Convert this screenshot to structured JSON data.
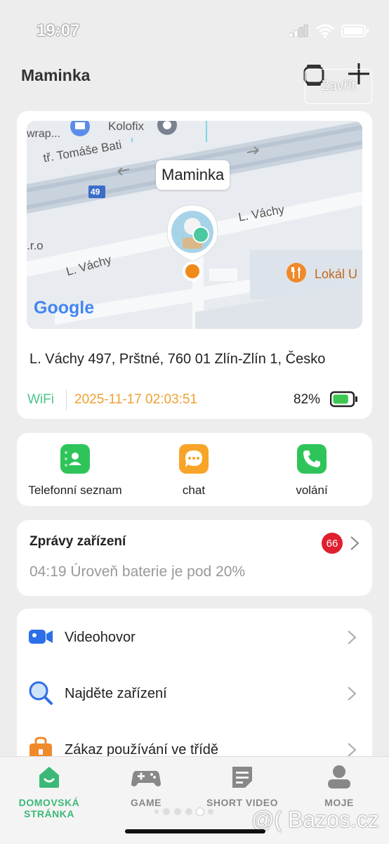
{
  "status": {
    "time": "19:07"
  },
  "header": {
    "title": "Maminka",
    "close_label": "Zavřít"
  },
  "location_card": {
    "map": {
      "pin_label": "Maminka",
      "street_1": "tř. Tomáše Bati",
      "street_2": "L. Váchy",
      "street_3": "L. Váchy",
      "poi_1": "Kolofix",
      "poi_2": "Lokál U",
      "poi_3": "wrap...",
      "road_number": "49",
      "edge_text": ".r.o",
      "provider": "Google"
    },
    "address": "L. Váchy 497, Prštné, 760 01 Zlín-Zlín 1, Česko",
    "connection": "WiFi",
    "timestamp": "2025-11-17 02:03:51",
    "battery_pct": "82%",
    "battery_level": 0.82
  },
  "quick_actions": [
    {
      "label": "Telefonní seznam",
      "icon": "contacts-icon",
      "color": "#2ec45a"
    },
    {
      "label": "chat",
      "icon": "chat-icon",
      "color": "#f7a428"
    },
    {
      "label": "volání",
      "icon": "phone-icon",
      "color": "#2ec45a"
    }
  ],
  "messages": {
    "title": "Zprávy zařízení",
    "badge": "66",
    "latest": "04:19 Úroveň baterie je pod 20%"
  },
  "menu": [
    {
      "label": "Videohovor",
      "icon": "video-camera-icon"
    },
    {
      "label": "Najděte zařízení",
      "icon": "magnifier-icon"
    },
    {
      "label": "Zákaz používání ve třídě",
      "icon": "lock-icon"
    }
  ],
  "bottom_nav": [
    {
      "label": "DOMOVSKÁ STRÁNKA",
      "icon": "home-icon",
      "active": true
    },
    {
      "label": "GAME",
      "icon": "gamepad-icon",
      "active": false
    },
    {
      "label": "SHORT VIDEO",
      "icon": "short-video-icon",
      "active": false
    },
    {
      "label": "MOJE",
      "icon": "user-icon",
      "active": false
    }
  ],
  "watermark": "@( Bazos.cz",
  "colors": {
    "accent_green": "#3cb878",
    "orange": "#f0a030",
    "badge_red": "#e02030"
  }
}
